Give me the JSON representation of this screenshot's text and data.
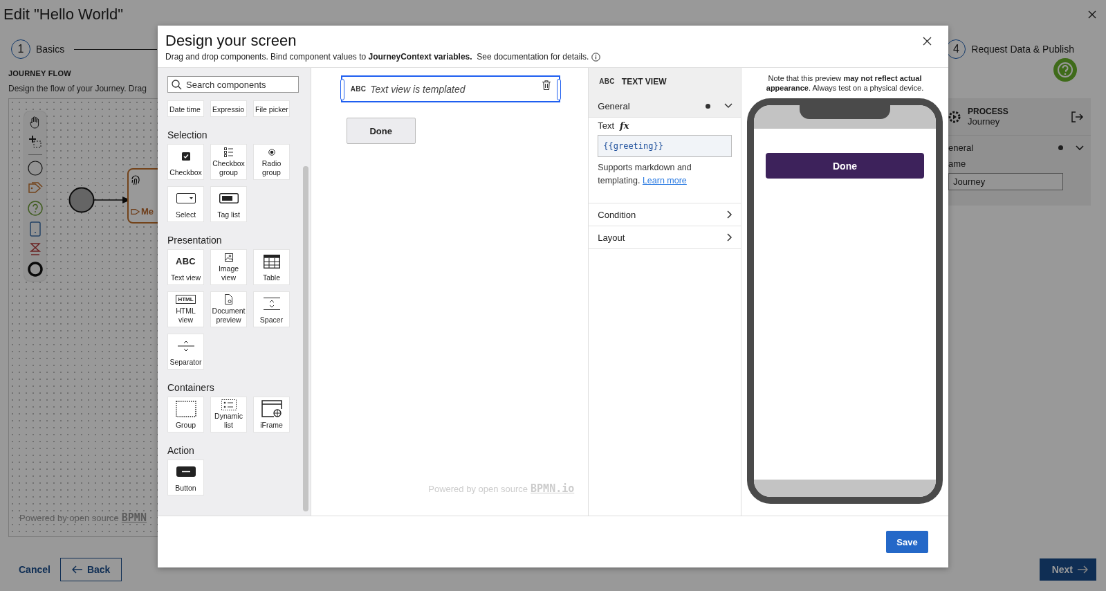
{
  "page": {
    "title": "Edit \"Hello World\"",
    "steps": [
      {
        "number": "1",
        "label": "Basics"
      },
      {
        "number": "4",
        "label": "Request Data & Publish"
      }
    ],
    "section_title": "JOURNEY FLOW",
    "section_description": "Design the flow of your Journey. Drag",
    "flow_task_label": "Me",
    "canvas_credit": "Powered by open source",
    "canvas_credit_logo": "BPMN",
    "process_panel": {
      "type": "PROCESS",
      "name": "Journey",
      "group": "eneral",
      "group_modified": true,
      "field_label": "ame",
      "field_value": "Journey"
    },
    "footer": {
      "cancel": "Cancel",
      "back": "Back",
      "next": "Next"
    }
  },
  "modal": {
    "title": "Design your screen",
    "subtitle": "Drag and drop components. Bind component values to **JourneyContext variables.**  See documentation for details.",
    "search": {
      "placeholder": "Search components"
    },
    "palette_partial": [
      "Date time",
      "Expressio",
      "File picker"
    ],
    "groups": [
      {
        "title": "Selection",
        "items": [
          {
            "label": "Checkbox",
            "kind": "checkbox"
          },
          {
            "label": "Checkbox group",
            "kind": "checklist"
          },
          {
            "label": "Radio group",
            "kind": "radio"
          },
          {
            "label": "Select",
            "kind": "select"
          },
          {
            "label": "Tag list",
            "kind": "taglist"
          }
        ]
      },
      {
        "title": "Presentation",
        "items": [
          {
            "label": "Text view",
            "kind": "text",
            "icon_text": "ABC"
          },
          {
            "label": "Image view",
            "kind": "image"
          },
          {
            "label": "Table",
            "kind": "table"
          },
          {
            "label": "HTML view",
            "kind": "html",
            "icon_text": "HTML"
          },
          {
            "label": "Document preview",
            "kind": "document"
          },
          {
            "label": "Spacer",
            "kind": "spacer"
          },
          {
            "label": "Separator",
            "kind": "separator"
          }
        ]
      },
      {
        "title": "Containers",
        "items": [
          {
            "label": "Group",
            "kind": "group"
          },
          {
            "label": "Dynamic list",
            "kind": "dynamiclist"
          },
          {
            "label": "iFrame",
            "kind": "iframe"
          }
        ]
      },
      {
        "title": "Action",
        "items": [
          {
            "label": "Button",
            "kind": "button"
          }
        ]
      }
    ],
    "canvas": {
      "component": {
        "type_label": "ABC",
        "text": "Text view is templated",
        "selected": true
      },
      "button": "Done",
      "credit": "Powered by open source",
      "credit_logo": "BPMN.io"
    },
    "properties": {
      "type_label": "ABC",
      "title": "TEXT VIEW",
      "sections": [
        {
          "title": "General",
          "expanded": true,
          "modified": true
        },
        {
          "title": "Condition",
          "expanded": false,
          "modified": false
        },
        {
          "title": "Layout",
          "expanded": false,
          "modified": false
        }
      ],
      "text_field": {
        "label": "Text",
        "expression_marker": "fx",
        "value": "{{greeting}}"
      },
      "help": "Supports markdown and templating.",
      "link": "Learn more"
    },
    "preview": {
      "note": "Note that this preview **may not reflect actual appearance**. Always test on a physical device.",
      "button": "Done"
    },
    "save": "Save"
  }
}
